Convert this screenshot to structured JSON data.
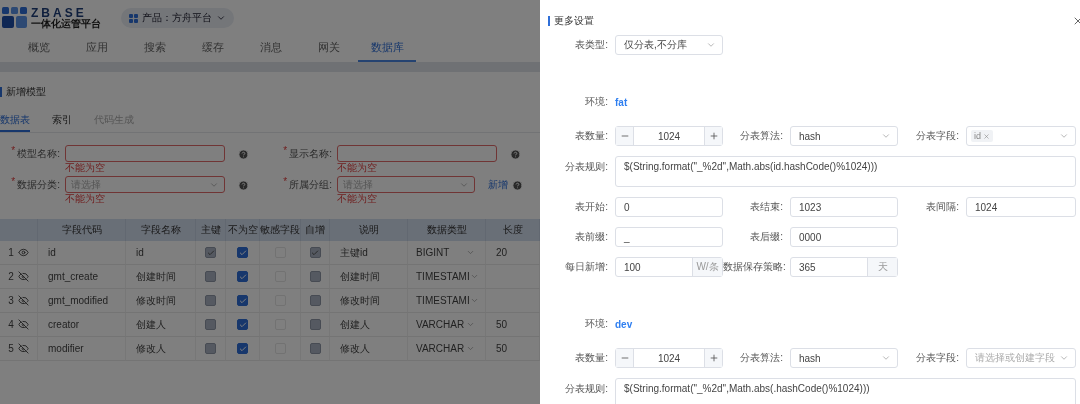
{
  "header": {
    "logo_title": "ZBASE",
    "logo_subtitle": "一体化运管平台",
    "product_selector": "产品：方舟平台"
  },
  "nav_tabs": [
    {
      "label": "概览",
      "selected": false
    },
    {
      "label": "应用",
      "selected": false
    },
    {
      "label": "搜索",
      "selected": false
    },
    {
      "label": "缓存",
      "selected": false
    },
    {
      "label": "消息",
      "selected": false
    },
    {
      "label": "网关",
      "selected": false
    },
    {
      "label": "数据库",
      "selected": true
    }
  ],
  "page": {
    "title": "新增模型",
    "tabs": [
      {
        "label": "数据表",
        "selected": true,
        "disabled": false
      },
      {
        "label": "索引",
        "selected": false,
        "disabled": false
      },
      {
        "label": "代码生成",
        "selected": false,
        "disabled": true
      }
    ],
    "fields": [
      {
        "kind": "input",
        "required_mark": "*",
        "label": "模型名称:",
        "error": "不能为空"
      },
      {
        "kind": "input",
        "required_mark": "*",
        "label": "显示名称:",
        "error": "不能为空"
      },
      {
        "kind": "select",
        "required_mark": "*",
        "label": "数据分类:",
        "placeholder": "请选择",
        "error": "不能为空"
      },
      {
        "kind": "select",
        "required_mark": "*",
        "label": "所属分组:",
        "placeholder": "请选择",
        "error": "不能为空",
        "link": "新增"
      }
    ]
  },
  "table": {
    "columns": [
      "字段代码",
      "字段名称",
      "主键",
      "不为空",
      "敏感字段",
      "自增",
      "说明",
      "数据类型",
      "长度"
    ],
    "rows": [
      {
        "index": "1",
        "visible": true,
        "code": "id",
        "name": "id",
        "checks": [
          {
            "checked": true,
            "disabled": true
          },
          {
            "checked": true,
            "disabled": false
          },
          {
            "checked": false,
            "disabled": false
          },
          {
            "checked": true,
            "disabled": true
          }
        ],
        "description": "主键id",
        "type": "BIGINT",
        "length": "20"
      },
      {
        "index": "2",
        "visible": false,
        "code": "gmt_create",
        "name": "创建时间",
        "checks": [
          {
            "checked": false,
            "disabled": true
          },
          {
            "checked": true,
            "disabled": false
          },
          {
            "checked": false,
            "disabled": false
          },
          {
            "checked": false,
            "disabled": true
          }
        ],
        "description": "创建时间",
        "type": "TIMESTAMI"
      },
      {
        "index": "3",
        "visible": false,
        "code": "gmt_modified",
        "name": "修改时间",
        "checks": [
          {
            "checked": false,
            "disabled": true
          },
          {
            "checked": true,
            "disabled": false
          },
          {
            "checked": false,
            "disabled": false
          },
          {
            "checked": false,
            "disabled": true
          }
        ],
        "description": "修改时间",
        "type": "TIMESTAMI"
      },
      {
        "index": "4",
        "visible": false,
        "code": "creator",
        "name": "创建人",
        "checks": [
          {
            "checked": false,
            "disabled": true
          },
          {
            "checked": true,
            "disabled": false
          },
          {
            "checked": false,
            "disabled": false
          },
          {
            "checked": false,
            "disabled": true
          }
        ],
        "description": "创建人",
        "type": "VARCHAR",
        "length": "50"
      },
      {
        "index": "5",
        "visible": false,
        "code": "modifier",
        "name": "修改人",
        "checks": [
          {
            "checked": false,
            "disabled": true
          },
          {
            "checked": true,
            "disabled": false
          },
          {
            "checked": false,
            "disabled": false
          },
          {
            "checked": false,
            "disabled": true
          }
        ],
        "description": "修改人",
        "type": "VARCHAR",
        "length": "50"
      }
    ]
  },
  "drawer": {
    "title": "更多设置",
    "table_type": {
      "label": "表类型:",
      "value": "仅分表,不分库"
    },
    "environments": [
      {
        "label": "环境:",
        "name": "fat",
        "count_label": "表数量:",
        "count": "1024",
        "algorithm_label": "分表算法:",
        "algorithm": "hash",
        "field_label": "分表字段:",
        "field_tags": [
          "id"
        ],
        "rule_label": "分表规则:",
        "rule": "$(String.format(\"_%2d\",Math.abs(id.hashCode()%1024)))",
        "extra_rows": [
          [
            {
              "label": "表开始:",
              "value": "0"
            },
            {
              "label": "表结束:",
              "value": "1023"
            },
            {
              "label": "表间隔:",
              "value": "1024"
            }
          ],
          [
            {
              "label": "表前缀:",
              "value": "_"
            },
            {
              "label": "表后缀:",
              "value": "0000"
            }
          ],
          [
            {
              "label": "每日新增:",
              "value": "100",
              "suffix": "W/条"
            },
            {
              "label": "数据保存策略:",
              "value": "365",
              "suffix": "天"
            }
          ]
        ]
      },
      {
        "label": "环境:",
        "name": "dev",
        "count_label": "表数量:",
        "count": "1024",
        "algorithm_label": "分表算法:",
        "algorithm": "hash",
        "field_label": "分表字段:",
        "field_placeholder": "请选择或创建字段",
        "rule_label": "分表规则:",
        "rule": "$(String.format(\"_%2d\",Math.abs(.hashCode()%1024)))"
      }
    ]
  }
}
